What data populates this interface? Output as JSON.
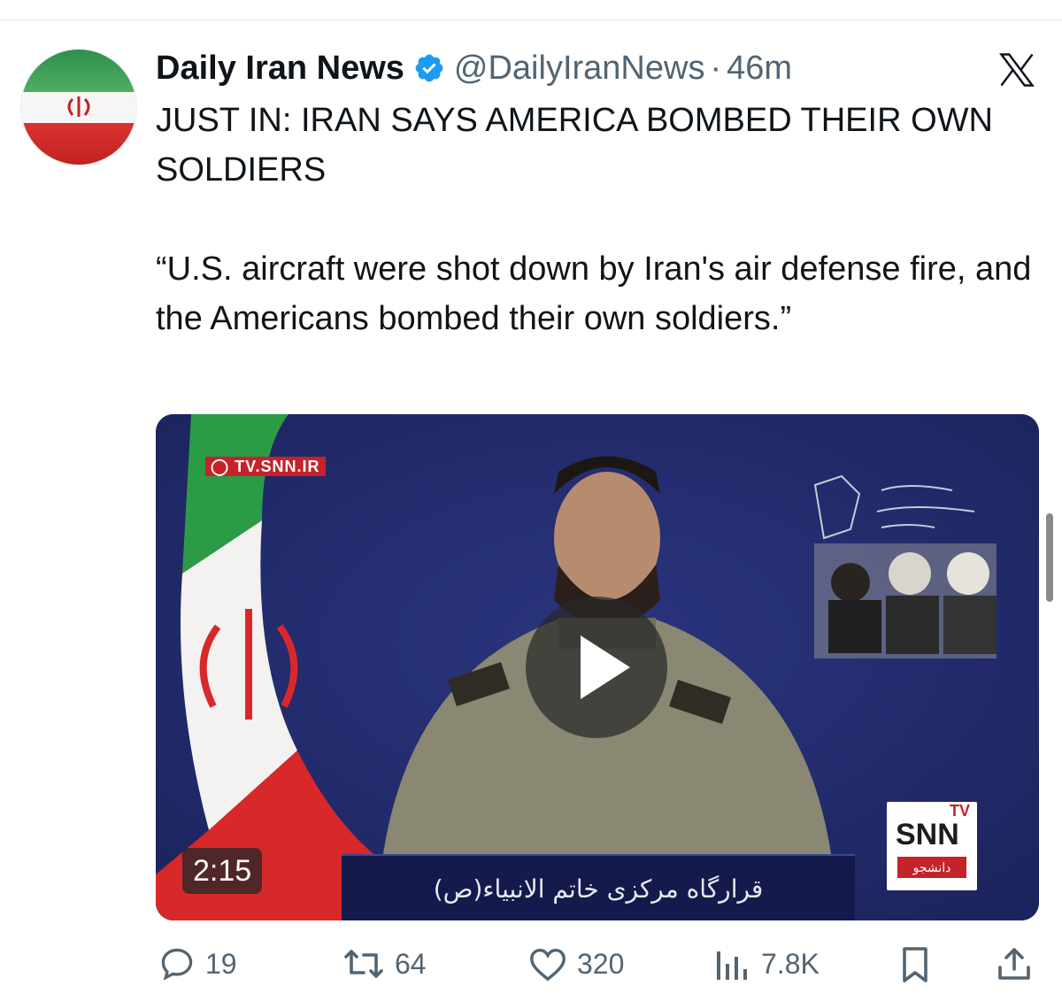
{
  "author": {
    "name": "Daily Iran News",
    "handle": "@DailyIranNews",
    "separator": "·",
    "time": "46m"
  },
  "tweet": {
    "title": "JUST IN: IRAN SAYS AMERICA BOMBED THEIR OWN SOLDIERS",
    "quote": "“U.S. aircraft were shot down by Iran's air defense fire, and the Americans bombed their own soldiers.”"
  },
  "media": {
    "watermark": "TV.SNN.IR",
    "channel_logo": "SNN",
    "channel_logo_tv": "TV",
    "channel_logo_sub": "دانشجو",
    "caption": "قرارگاه مرکزی خاتم الانبیاء(ص)",
    "duration": "2:15"
  },
  "actions": {
    "replies": "19",
    "reposts": "64",
    "likes": "320",
    "views": "7.8K"
  },
  "icons": {
    "verified": "verified-badge-icon",
    "x_logo": "x-logo-icon",
    "reply": "reply-icon",
    "repost": "repost-icon",
    "like": "heart-icon",
    "views": "views-icon",
    "bookmark": "bookmark-icon",
    "share": "share-icon",
    "play": "play-icon"
  },
  "colors": {
    "verified": "#1d9bf0",
    "text": "#0f1419",
    "secondary": "#536471"
  }
}
